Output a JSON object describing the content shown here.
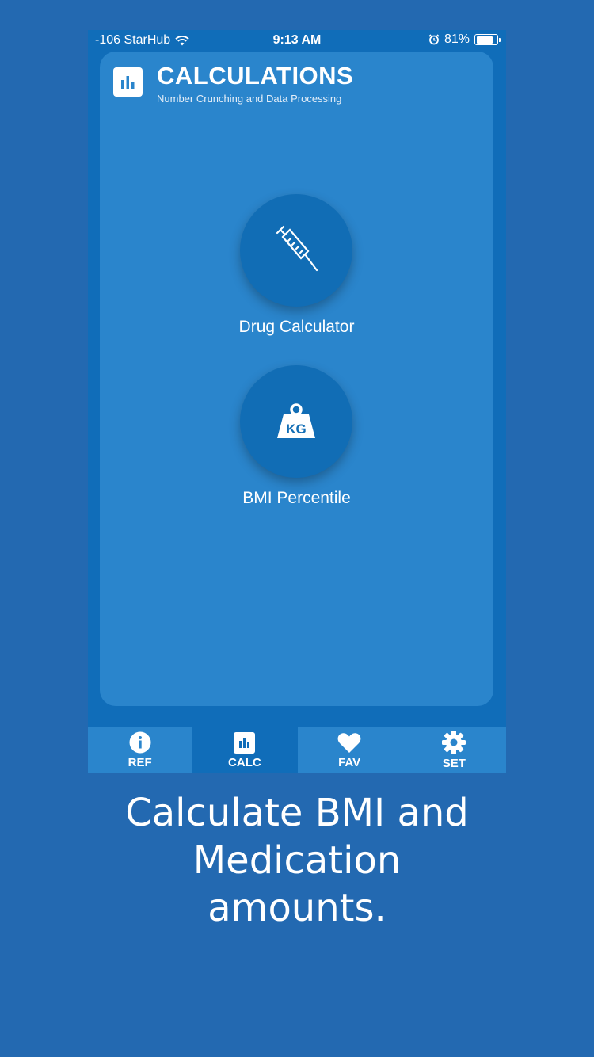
{
  "statusbar": {
    "carrier": "-106 StarHub",
    "time": "9:13 AM",
    "battery": "81%"
  },
  "header": {
    "title": "CALCULATIONS",
    "subtitle": "Number Crunching and Data Processing"
  },
  "tools": [
    {
      "label": "Drug Calculator",
      "icon": "syringe-icon"
    },
    {
      "label": "BMI Percentile",
      "icon": "kg-weight-icon",
      "icon_text": "KG"
    }
  ],
  "tabs": [
    {
      "label": "REF",
      "icon": "info-icon",
      "active": false
    },
    {
      "label": "CALC",
      "icon": "chart-icon",
      "active": true
    },
    {
      "label": "FAV",
      "icon": "heart-icon",
      "active": false
    },
    {
      "label": "SET",
      "icon": "gear-icon",
      "active": false
    }
  ],
  "caption": {
    "line1": "Calculate BMI and",
    "line2": "Medication",
    "line3": "amounts."
  },
  "colors": {
    "background": "#2369b1",
    "phone": "#106db9",
    "card": "#2a85cc"
  }
}
